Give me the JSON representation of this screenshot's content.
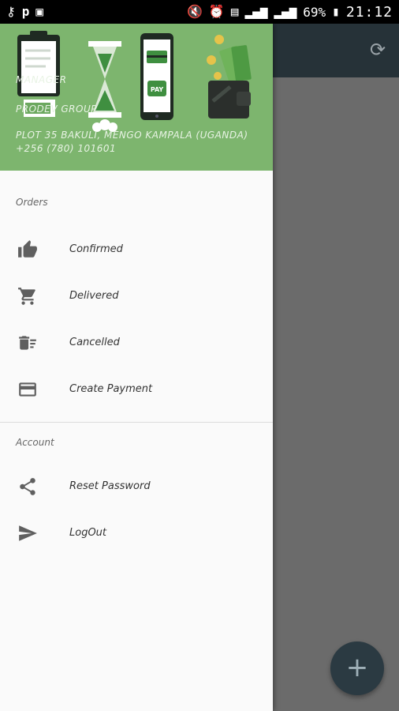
{
  "status_bar": {
    "battery_percent": "69%",
    "time": "21:12"
  },
  "drawer_header": {
    "role": "MANAGER",
    "organization": "PRODEV GROUP",
    "address": "PLOT 35 BAKULI, MENGO KAMPALA (UGANDA)",
    "phone": "+256 (780) 101601",
    "pay_label": "PAY"
  },
  "sections": {
    "orders": {
      "title": "Orders",
      "items": [
        {
          "label": "Confirmed",
          "icon": "thumb-up-icon"
        },
        {
          "label": "Delivered",
          "icon": "cart-icon"
        },
        {
          "label": "Cancelled",
          "icon": "delete-sweep-icon"
        },
        {
          "label": "Create Payment",
          "icon": "credit-card-icon"
        }
      ]
    },
    "account": {
      "title": "Account",
      "items": [
        {
          "label": "Reset Password",
          "icon": "share-icon"
        },
        {
          "label": "LogOut",
          "icon": "send-icon"
        }
      ]
    }
  },
  "colors": {
    "header_green": "#7db56e",
    "app_bar": "#263238",
    "scrim": "#6b6b6b",
    "fab": "#2b3a42"
  }
}
